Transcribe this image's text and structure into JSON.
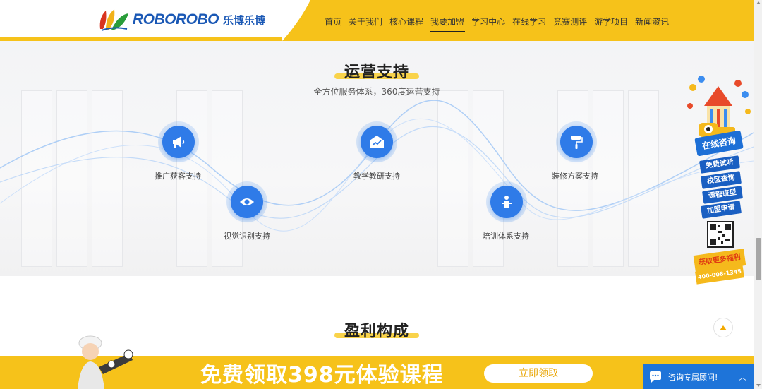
{
  "header": {
    "logo_text": "ROBOROBO",
    "logo_cn": "乐博乐博",
    "nav": [
      {
        "label": "首页",
        "active": false
      },
      {
        "label": "关于我们",
        "active": false
      },
      {
        "label": "核心课程",
        "active": false
      },
      {
        "label": "我要加盟",
        "active": true
      },
      {
        "label": "学习中心",
        "active": false
      },
      {
        "label": "在线学习",
        "active": false
      },
      {
        "label": "竞赛测评",
        "active": false
      },
      {
        "label": "游学项目",
        "active": false
      },
      {
        "label": "新闻资讯",
        "active": false
      }
    ]
  },
  "ops": {
    "title": "运营支持",
    "subtitle": "全方位服务体系，360度运营支持",
    "nodes": [
      {
        "label": "推广获客支持",
        "icon": "megaphone-icon"
      },
      {
        "label": "视觉识别支持",
        "icon": "eye-icon"
      },
      {
        "label": "教学教研支持",
        "icon": "chart-envelope-icon"
      },
      {
        "label": "培训体系支持",
        "icon": "lectern-icon"
      },
      {
        "label": "装修方案支持",
        "icon": "paint-roller-icon"
      }
    ]
  },
  "profit": {
    "title": "盈利构成"
  },
  "float_panel": {
    "head": "在线咨询",
    "buttons": [
      "免费试听",
      "校区查询",
      "课程班型",
      "加盟申请"
    ],
    "promo": "获取更多福利",
    "phone": "400-008-1345"
  },
  "banner": {
    "text": "免费领取398元体验课程",
    "button": "立即领取"
  },
  "chat": {
    "label": "咨询专属顾问!",
    "toggle": "︿"
  },
  "colors": {
    "brand_yellow": "#f6c21a",
    "brand_blue": "#1a58b5",
    "node_blue": "#2f7be8"
  }
}
